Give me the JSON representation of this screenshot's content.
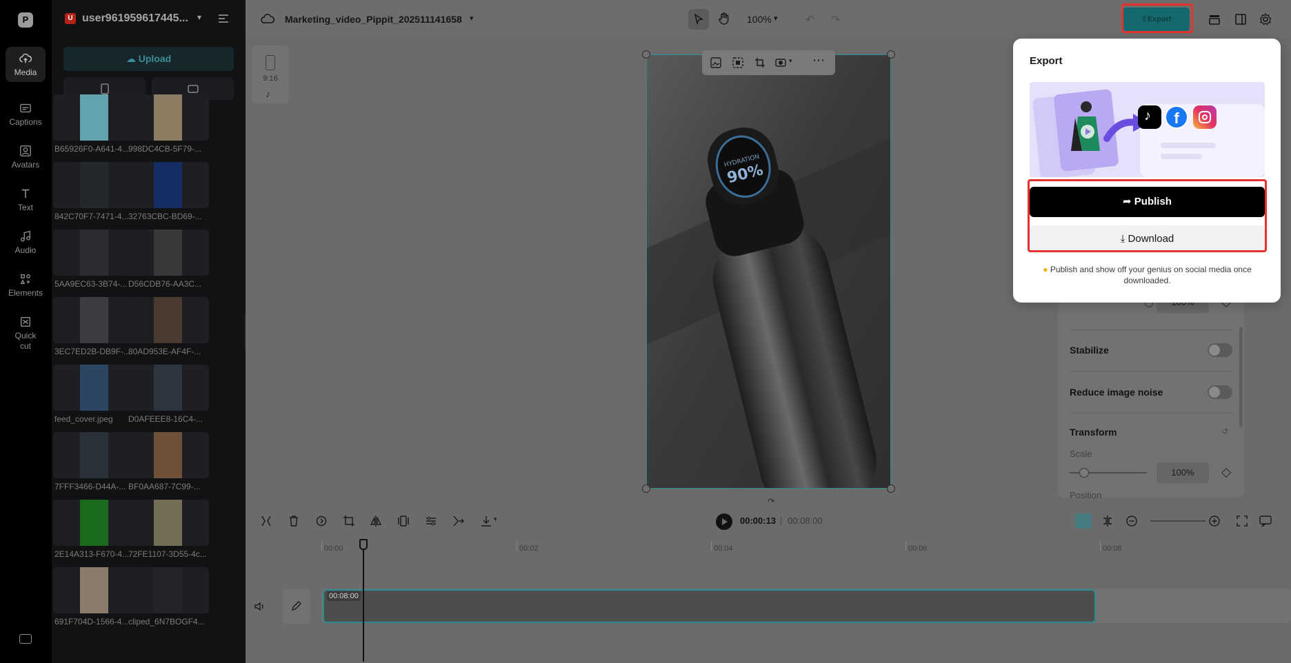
{
  "rail": {
    "items": [
      {
        "label": "Media",
        "icon": "upload-cloud-icon"
      },
      {
        "label": "Captions",
        "icon": "captions-icon"
      },
      {
        "label": "Avatars",
        "icon": "avatar-icon"
      },
      {
        "label": "Text",
        "icon": "text-icon"
      },
      {
        "label": "Audio",
        "icon": "music-note-icon"
      },
      {
        "label": "Elements",
        "icon": "elements-icon"
      },
      {
        "label": "Quick cut",
        "icon": "quick-cut-icon"
      }
    ]
  },
  "media_panel": {
    "user_badge": "U",
    "user_name": "user961959617445...",
    "upload_label": "Upload",
    "items": [
      {
        "label": "B65926F0-A641-4...",
        "color": "#5fa4ae"
      },
      {
        "label": "998DC4CB-5F79-...",
        "color": "#8c7d62"
      },
      {
        "label": "842C70F7-7471-4...",
        "color": "#24282b"
      },
      {
        "label": "32763CBC-BD69-...",
        "color": "#132e63"
      },
      {
        "label": "5AA9EC63-3B74-...",
        "color": "#2a2c30"
      },
      {
        "label": "D56CDB76-AA3C...",
        "color": "#383838"
      },
      {
        "label": "3EC7ED2B-DB9F-...",
        "color": "#3a3c3f"
      },
      {
        "label": "80AD953E-AF4F-...",
        "color": "#4a3b2f"
      },
      {
        "label": "feed_cover.jpeg",
        "color": "#2c4563"
      },
      {
        "label": "D0AFEEE8-16C4-...",
        "color": "#2d3640"
      },
      {
        "label": "7FFF3466-D44A-...",
        "color": "#2a3138"
      },
      {
        "label": "BF0AA687-7C99-...",
        "color": "#6e5138"
      },
      {
        "label": "2E14A313-F670-4...",
        "color": "#1c6b1c"
      },
      {
        "label": "72FE1107-3D55-4c...",
        "color": "#756e57"
      },
      {
        "label": "691F704D-1566-4...",
        "color": "#8b7d6c"
      },
      {
        "label": "cliped_6N7BOGF4...",
        "color": "#242528"
      }
    ]
  },
  "topbar": {
    "project_title": "Marketing_video_Pippit_202511141658",
    "zoom": "100%",
    "export_label": "Export"
  },
  "canvas": {
    "aspect_ratio": "9:16",
    "bottle_display": "HYDRATION 90%"
  },
  "properties": {
    "opacity_value": "100%",
    "stabilize_label": "Stabilize",
    "noise_label": "Reduce image noise",
    "transform_label": "Transform",
    "scale_label": "Scale",
    "scale_value": "100%",
    "position_label": "Position"
  },
  "timeline": {
    "current_time": "00:00:13",
    "separator": "|",
    "total_time": "00:08:00",
    "ruler": [
      "00:00",
      "00:02",
      "00:04",
      "00:06",
      "00:08"
    ],
    "clip_duration": "00:08:00"
  },
  "export_popup": {
    "title": "Export",
    "publish_label": "Publish",
    "download_label": "Download",
    "note": "Publish and show off your genius on social media once downloaded.",
    "note_icon": "lightbulb-icon",
    "platforms": [
      "tiktok-icon",
      "facebook-icon",
      "instagram-icon"
    ]
  },
  "colors": {
    "accent": "#2a8c93",
    "highlight": "#e4322f",
    "publish_bg": "#000000"
  }
}
